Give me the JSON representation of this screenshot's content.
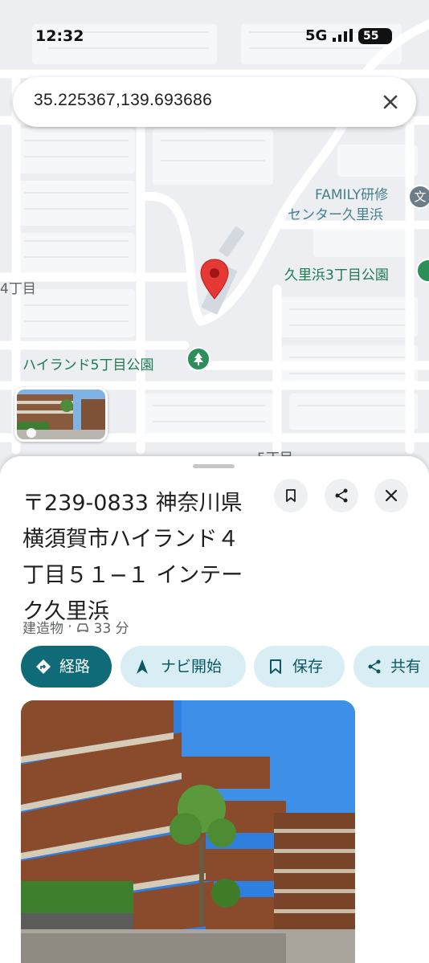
{
  "status": {
    "time": "12:32",
    "network": "5G",
    "battery": "55"
  },
  "search": {
    "query": "35.225367,139.693686"
  },
  "map_labels": {
    "family": "FAMILY研修",
    "family2": "センター久里浜",
    "edu_icon": "文",
    "park1": "久里浜3丁目公園",
    "park2": "ハイランド5丁目公園",
    "street1": "4丁目",
    "street2": "5丁目"
  },
  "place": {
    "title": "〒239-0833 神奈川県横須賀市ハイランド４丁目５１−１ インテーク久里浜",
    "category": "建造物",
    "separator": "·",
    "drive_time": "33 分"
  },
  "actions": [
    {
      "label": "経路",
      "icon": "directions-icon"
    },
    {
      "label": "ナビ開始",
      "icon": "navigation-icon"
    },
    {
      "label": "保存",
      "icon": "bookmark-icon"
    },
    {
      "label": "共有",
      "icon": "share-icon"
    }
  ],
  "colors": {
    "primary_chip": "#0f6b78",
    "chip": "#d8eef4",
    "park": "#2c8e58",
    "pin": "#e53935"
  }
}
